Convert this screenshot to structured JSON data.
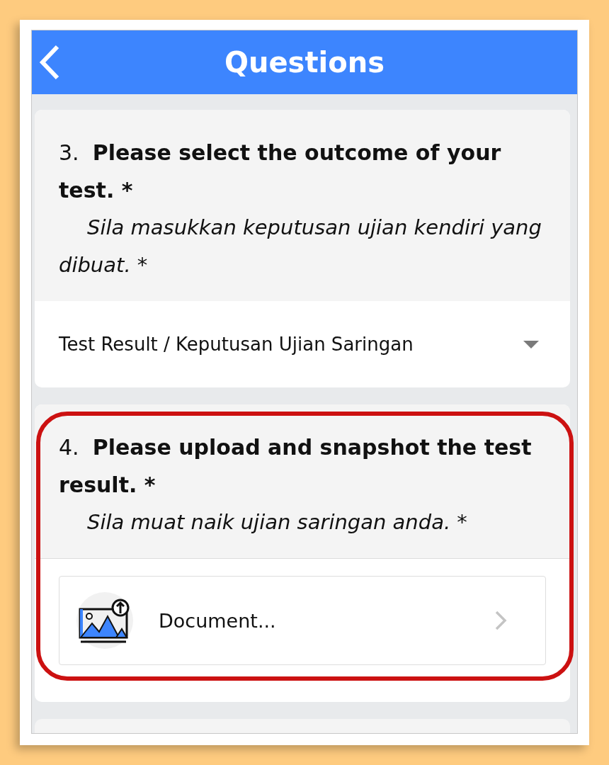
{
  "header": {
    "title": "Questions"
  },
  "questions": [
    {
      "number": "3.",
      "title": "Please select the outcome of your test. *",
      "subtitle": "Sila masukkan keputusan ujian kendiri yang dibuat. *",
      "kind": "dropdown",
      "value": "Test Result / Keputusan Ujian Saringan",
      "highlighted": false
    },
    {
      "number": "4.",
      "title": "Please upload and snapshot the test result. *",
      "subtitle": "Sila muat naik ujian saringan anda. *",
      "kind": "upload",
      "value": "Document...",
      "highlighted": true
    }
  ]
}
